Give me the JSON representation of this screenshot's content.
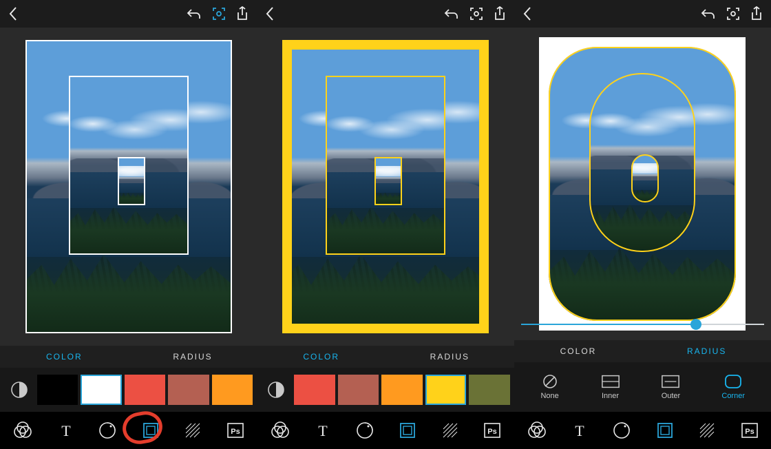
{
  "colors": {
    "accent": "#2aa5d9",
    "annotation": "#e43d2c"
  },
  "panel_a": {
    "topbar": {
      "scan_active": true
    },
    "tabs": {
      "color": "COLOR",
      "radius": "RADIUS",
      "active": "color"
    },
    "swatches": [
      {
        "color": "#000000",
        "selected": false
      },
      {
        "color": "#ffffff",
        "selected": true
      },
      {
        "color": "#ec5043",
        "selected": false
      },
      {
        "color": "#b46052",
        "selected": false
      },
      {
        "color": "#ff9a1f",
        "selected": false
      }
    ],
    "bottom_active": "frame",
    "frame": {
      "border_color": "#ffffff",
      "style": "square",
      "thickness_px": 2,
      "thick_outer": false
    },
    "annotation_circle": true
  },
  "panel_b": {
    "topbar": {
      "scan_active": false
    },
    "tabs": {
      "color": "COLOR",
      "radius": "RADIUS",
      "active": "color"
    },
    "swatches": [
      {
        "color": "#ec5043",
        "selected": false
      },
      {
        "color": "#b46052",
        "selected": false
      },
      {
        "color": "#ff9a1f",
        "selected": false
      },
      {
        "color": "#ffd21a",
        "selected": true
      },
      {
        "color": "#6a7236",
        "selected": false
      }
    ],
    "bottom_active": "frame",
    "frame": {
      "border_color": "#ffd21a",
      "style": "square",
      "thickness_px": 2,
      "thick_outer": true,
      "outer_thickness_px": 14
    }
  },
  "panel_c": {
    "topbar": {
      "scan_active": false
    },
    "tabs": {
      "color": "COLOR",
      "radius": "RADIUS",
      "active": "radius"
    },
    "radius_options": [
      {
        "name": "none",
        "label": "None"
      },
      {
        "name": "inner",
        "label": "Inner"
      },
      {
        "name": "outer",
        "label": "Outer"
      },
      {
        "name": "corner",
        "label": "Corner"
      }
    ],
    "radius_selected": "corner",
    "slider": {
      "value": 72,
      "min": 0,
      "max": 100
    },
    "bottom_active": "frame",
    "frame": {
      "border_color": "#ffd21a",
      "style": "rounded",
      "outer_thick": true,
      "outer_thickness_px": 14
    }
  }
}
